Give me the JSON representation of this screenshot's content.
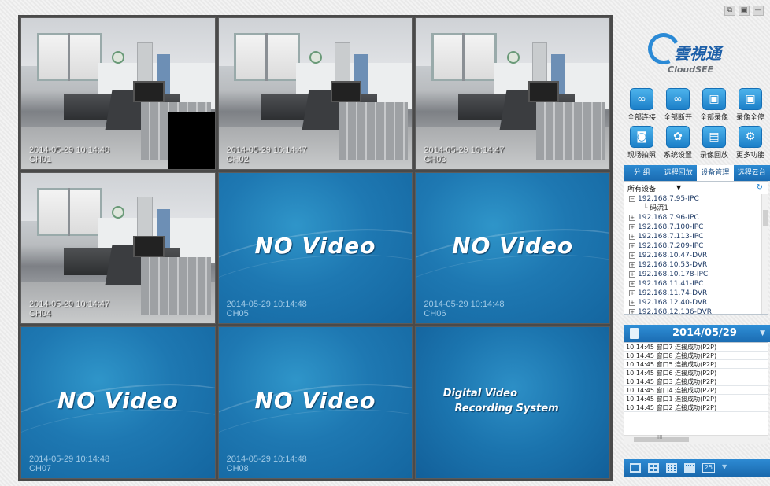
{
  "window_controls": [
    "⧉",
    "▣",
    "—"
  ],
  "cells": [
    {
      "type": "camera",
      "time": "2014-05-29 10:14:48",
      "channel": "CH01",
      "blackbox": true
    },
    {
      "type": "camera",
      "time": "2014-05-29 10:14:47",
      "channel": "CH02"
    },
    {
      "type": "camera",
      "time": "2014-05-29 10:14:47",
      "channel": "CH03"
    },
    {
      "type": "camera",
      "time": "2014-05-29 10:14:47",
      "channel": "CH04"
    },
    {
      "type": "novideo",
      "text": "NO Video",
      "time": "2014-05-29 10:14:48",
      "channel": "CH05"
    },
    {
      "type": "novideo",
      "text": "NO Video",
      "time": "2014-05-29 10:14:48",
      "channel": "CH06"
    },
    {
      "type": "novideo",
      "text": "NO Video",
      "time": "2014-05-29 10:14:48",
      "channel": "CH07"
    },
    {
      "type": "novideo",
      "text": "NO Video",
      "time": "2014-05-29 10:14:48",
      "channel": "CH08"
    },
    {
      "type": "dvr",
      "line1": "Digital Video",
      "line2": "Recording System"
    }
  ],
  "logo": {
    "brand": "雲視通",
    "sub": "CloudSEE"
  },
  "quick_buttons": [
    {
      "label": "全部连接",
      "icon": "link-icon",
      "glyph": "∞"
    },
    {
      "label": "全部断开",
      "icon": "unlink-icon",
      "glyph": "∞"
    },
    {
      "label": "全部录像",
      "icon": "record-all-icon",
      "glyph": "▣"
    },
    {
      "label": "录像全停",
      "icon": "stop-record-icon",
      "glyph": "▣"
    },
    {
      "label": "现场拍照",
      "icon": "camera-icon",
      "glyph": "◙"
    },
    {
      "label": "系统设置",
      "icon": "gear-icon",
      "glyph": "✿"
    },
    {
      "label": "录像回放",
      "icon": "playback-icon",
      "glyph": "▤"
    },
    {
      "label": "更多功能",
      "icon": "more-icon",
      "glyph": "⚙"
    }
  ],
  "tabs": [
    "分 组",
    "远程回放",
    "设备管理",
    "远程云台"
  ],
  "active_tab": 2,
  "tree": {
    "header": "所有设备",
    "nodes": [
      {
        "label": "192.168.7.95-IPC",
        "expanded": true
      },
      {
        "label": "码流1",
        "child": true
      },
      {
        "label": "192.168.7.96-IPC"
      },
      {
        "label": "192.168.7.100-IPC"
      },
      {
        "label": "192.168.7.113-IPC"
      },
      {
        "label": "192.168.7.209-IPC"
      },
      {
        "label": "192.168.10.47-DVR"
      },
      {
        "label": "192.168.10.53-DVR"
      },
      {
        "label": "192.168.10.178-IPC"
      },
      {
        "label": "192.168.11.41-IPC"
      },
      {
        "label": "192.168.11.74-DVR"
      },
      {
        "label": "192.168.12.40-DVR"
      },
      {
        "label": "192.168.12.136-DVR"
      }
    ]
  },
  "date": "2014/05/29",
  "log": [
    "10:14:45 窗口7 连接成功(P2P)",
    "10:14:45 窗口8 连接成功(P2P)",
    "10:14:45 窗口5 连接成功(P2P)",
    "10:14:45 窗口6 连接成功(P2P)",
    "10:14:45 窗口3 连接成功(P2P)",
    "10:14:45 窗口4 连接成功(P2P)",
    "10:14:45 窗口1 连接成功(P2P)",
    "10:14:45 窗口2 连接成功(P2P)"
  ],
  "scroll_mid": "III",
  "layouts": [
    {
      "name": "layout-1x1-button",
      "n": 1
    },
    {
      "name": "layout-2x2-button",
      "n": 2
    },
    {
      "name": "layout-3x3-button",
      "n": 3
    },
    {
      "name": "layout-4x4-button",
      "n": 4
    },
    {
      "name": "layout-25-button",
      "label": "25"
    }
  ]
}
